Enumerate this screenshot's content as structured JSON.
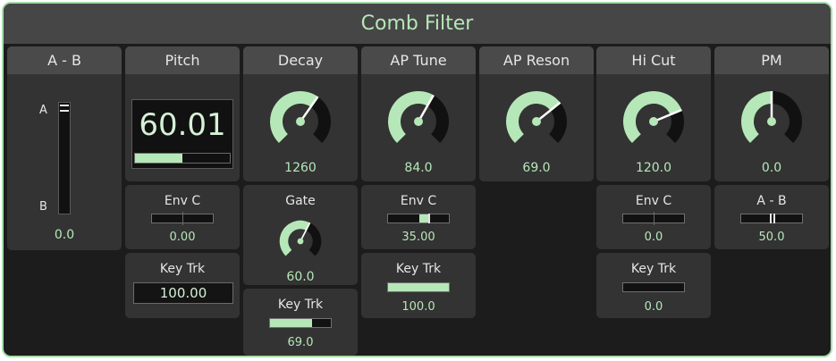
{
  "title": "Comb Filter",
  "colors": {
    "accent": "#b6e7b8",
    "panel": "#333333",
    "header": "#4a4a4a",
    "background": "#1c1c1c"
  },
  "ab": {
    "label": "A - B",
    "top_label": "A",
    "bottom_label": "B",
    "value": "0.0"
  },
  "pitch": {
    "label": "Pitch",
    "display": "60.01",
    "bar_fraction": 0.5,
    "env": {
      "label": "Env C",
      "value": "0.00"
    },
    "keytrk": {
      "label": "Key Trk",
      "value": "100.00"
    }
  },
  "decay": {
    "label": "Decay",
    "value": "1260",
    "knob_fraction": 0.63,
    "gate": {
      "label": "Gate",
      "value": "60.0",
      "knob_fraction": 0.6
    },
    "keytrk": {
      "label": "Key Trk",
      "value": "69.0",
      "bar_fraction": 0.69
    }
  },
  "aptune": {
    "label": "AP Tune",
    "value": "84.0",
    "knob_fraction": 0.61,
    "env": {
      "label": "Env C",
      "value": "35.00"
    },
    "keytrk": {
      "label": "Key Trk",
      "value": "100.0",
      "bar_fraction": 1.0
    }
  },
  "apreson": {
    "label": "AP Reson",
    "value": "69.0",
    "knob_fraction": 0.69
  },
  "hicut": {
    "label": "Hi Cut",
    "value": "120.0",
    "knob_fraction": 0.75,
    "env": {
      "label": "Env C",
      "value": "0.0"
    },
    "keytrk": {
      "label": "Key Trk",
      "value": "0.0",
      "bar_fraction": 0.0
    }
  },
  "pm": {
    "label": "PM",
    "value": "0.0",
    "knob_fraction": 0.5,
    "ab": {
      "label": "A - B",
      "value": "50.0"
    }
  }
}
